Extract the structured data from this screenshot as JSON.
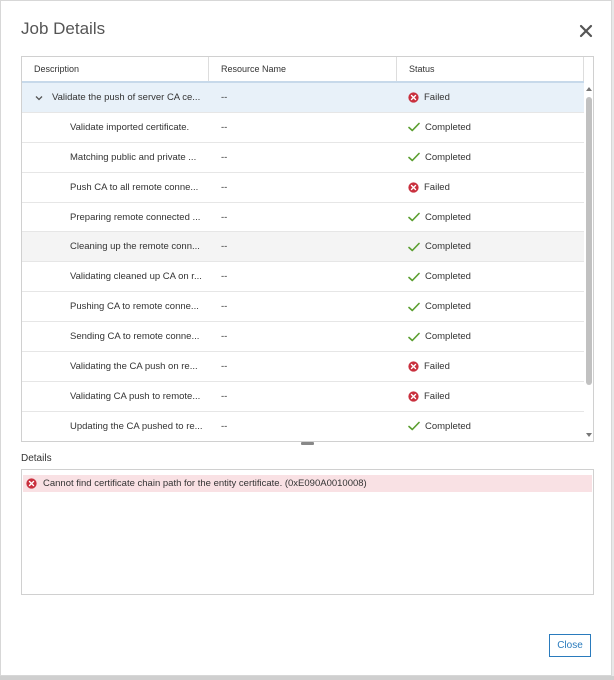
{
  "dialog": {
    "title": "Job Details",
    "close_button_label": "Close"
  },
  "grid": {
    "columns": [
      "Description",
      "Resource Name",
      "Status"
    ],
    "rows": [
      {
        "description": "Validate the push of server CA ce...",
        "resource": "--",
        "status": "Failed",
        "parent": true
      },
      {
        "description": "Validate imported certificate.",
        "resource": "--",
        "status": "Completed"
      },
      {
        "description": "Matching public and private ...",
        "resource": "--",
        "status": "Completed"
      },
      {
        "description": "Push CA to all remote conne...",
        "resource": "--",
        "status": "Failed"
      },
      {
        "description": "Preparing remote connected ...",
        "resource": "--",
        "status": "Completed"
      },
      {
        "description": "Cleaning up the remote conn...",
        "resource": "--",
        "status": "Completed"
      },
      {
        "description": "Validating cleaned up CA on r...",
        "resource": "--",
        "status": "Completed"
      },
      {
        "description": "Pushing CA to remote conne...",
        "resource": "--",
        "status": "Completed"
      },
      {
        "description": "Sending CA to remote conne...",
        "resource": "--",
        "status": "Completed"
      },
      {
        "description": "Validating the CA push on re...",
        "resource": "--",
        "status": "Failed"
      },
      {
        "description": "Validating CA push to remote...",
        "resource": "--",
        "status": "Failed"
      },
      {
        "description": "Updating the CA pushed to re...",
        "resource": "--",
        "status": "Completed"
      }
    ]
  },
  "details": {
    "label": "Details",
    "error_message": "Cannot find certificate chain path for the entity certificate. (0xE090A0010008)"
  },
  "colors": {
    "failed": "#c9303e",
    "completed": "#5a9e2f",
    "accent": "#2a7bbd",
    "selected_row": "#e8f1f9"
  },
  "icons": {
    "close": "close-icon",
    "expand": "chevron-down-icon",
    "failed": "error-circle-icon",
    "completed": "checkmark-icon"
  }
}
